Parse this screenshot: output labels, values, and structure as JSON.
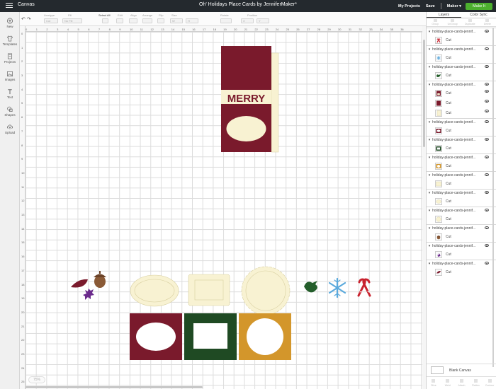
{
  "topbar": {
    "app_title": "Canvas",
    "doc_title": "Oh' Holidays Place Cards by JenniferMaker*",
    "my_projects": "My Projects",
    "save": "Save",
    "machine": "Maker",
    "make_it": "Make It"
  },
  "toolbar": {
    "linetype_label": "Linetype",
    "linetype_value": "Cut",
    "fill_label": "Fill",
    "fill_value": "No Fill",
    "select_all": "Select All",
    "edit": "Edit",
    "align": "Align",
    "arrange": "Arrange",
    "flip": "Flip",
    "size": "Size",
    "size_w": "W",
    "size_h": "H",
    "rotate": "Rotate",
    "position": "Position",
    "position_x": "X",
    "position_y": "Y"
  },
  "leftnav": [
    {
      "label": "New",
      "icon": "plus-icon"
    },
    {
      "label": "Templates",
      "icon": "shirt-icon"
    },
    {
      "label": "Projects",
      "icon": "folder-icon"
    },
    {
      "label": "Images",
      "icon": "image-icon"
    },
    {
      "label": "Text",
      "icon": "text-icon"
    },
    {
      "label": "Shapes",
      "icon": "shapes-icon"
    },
    {
      "label": "Upload",
      "icon": "upload-icon"
    }
  ],
  "ruler": {
    "top": [
      "0",
      "1",
      "2",
      "3",
      "4",
      "5",
      "6",
      "7",
      "8",
      "9",
      "10",
      "11",
      "12",
      "13",
      "14",
      "15",
      "16",
      "17",
      "18",
      "19",
      "20",
      "21",
      "22",
      "23",
      "24",
      "25",
      "26",
      "27",
      "28",
      "29",
      "30",
      "31",
      "32",
      "33",
      "34",
      "35",
      "36"
    ],
    "left": [
      "0",
      "1",
      "2",
      "3",
      "4",
      "5",
      "6",
      "7",
      "8",
      "9",
      "10",
      "11",
      "12",
      "13",
      "14",
      "15",
      "16",
      "17",
      "18",
      "19",
      "20",
      "21",
      "22",
      "23",
      "24",
      "25",
      "26"
    ]
  },
  "canvas": {
    "card_text": "MERRY",
    "zoom": "75%"
  },
  "panel": {
    "tabs": [
      "Layers",
      "Color Sync"
    ],
    "actions": [
      "Group",
      "UnGroup",
      "Duplicate",
      "Delete"
    ],
    "group_name": "holiday-place-cards-jennif...",
    "cut_label": "Cut",
    "blank_canvas": "Blank Canvas",
    "footer": [
      "Slice",
      "Weld",
      "Attach",
      "Flatten",
      "Contour"
    ]
  },
  "colors": {
    "burgundy": "#7a1a2c",
    "cream": "#f8f2d2",
    "green": "#1f4a23",
    "mustard": "#d3962b",
    "brown": "#8a5a36",
    "purple": "#6b2a8c",
    "snow": "#5aa9dc",
    "candy_red": "#c8222e",
    "bird_green": "#245e2b"
  }
}
